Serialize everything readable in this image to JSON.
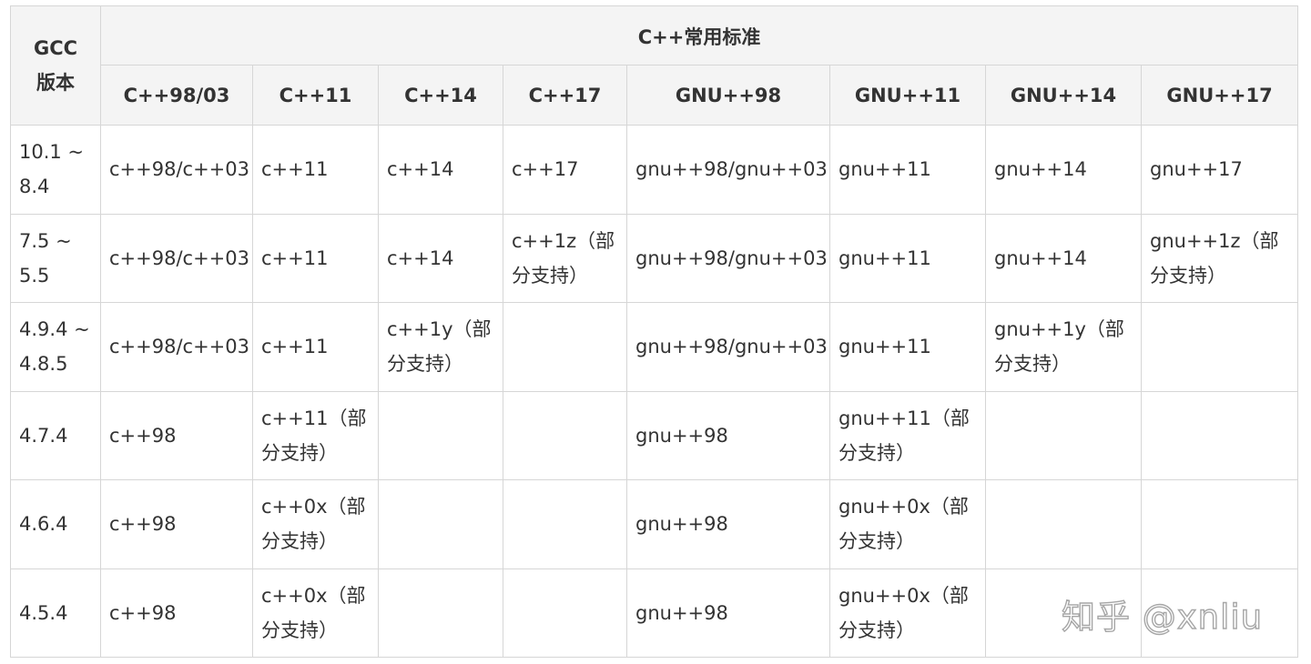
{
  "table": {
    "corner_header": "GCC\n版本",
    "group_header": "C++常用标准",
    "columns": [
      "C++98/03",
      "C++11",
      "C++14",
      "C++17",
      "GNU++98",
      "GNU++11",
      "GNU++14",
      "GNU++17"
    ],
    "rows": [
      {
        "version": "10.1 ~\n8.4",
        "cells": [
          "c++98/c++03",
          "c++11",
          "c++14",
          "c++17",
          "gnu++98/gnu++03",
          "gnu++11",
          "gnu++14",
          "gnu++17"
        ]
      },
      {
        "version": "7.5 ~\n5.5",
        "cells": [
          "c++98/c++03",
          "c++11",
          "c++14",
          "c++1z（部\n分支持）",
          "gnu++98/gnu++03",
          "gnu++11",
          "gnu++14",
          "gnu++1z（部\n分支持）"
        ]
      },
      {
        "version": "4.9.4 ~\n4.8.5",
        "cells": [
          "c++98/c++03",
          "c++11",
          "c++1y（部\n分支持）",
          "",
          "gnu++98/gnu++03",
          "gnu++11",
          "gnu++1y（部\n分支持）",
          ""
        ]
      },
      {
        "version": "4.7.4",
        "cells": [
          "c++98",
          "c++11（部\n分支持）",
          "",
          "",
          "gnu++98",
          "gnu++11（部\n分支持）",
          "",
          ""
        ]
      },
      {
        "version": "4.6.4",
        "cells": [
          "c++98",
          "c++0x（部\n分支持）",
          "",
          "",
          "gnu++98",
          "gnu++0x（部\n分支持）",
          "",
          ""
        ]
      },
      {
        "version": "4.5.4",
        "cells": [
          "c++98",
          "c++0x（部\n分支持）",
          "",
          "",
          "gnu++98",
          "gnu++0x（部\n分支持）",
          "",
          ""
        ]
      }
    ]
  },
  "watermark": "知乎 @xnliu",
  "colors": {
    "header_background": "#f4f4f4",
    "border": "#d6d6d6",
    "text": "#333333"
  }
}
